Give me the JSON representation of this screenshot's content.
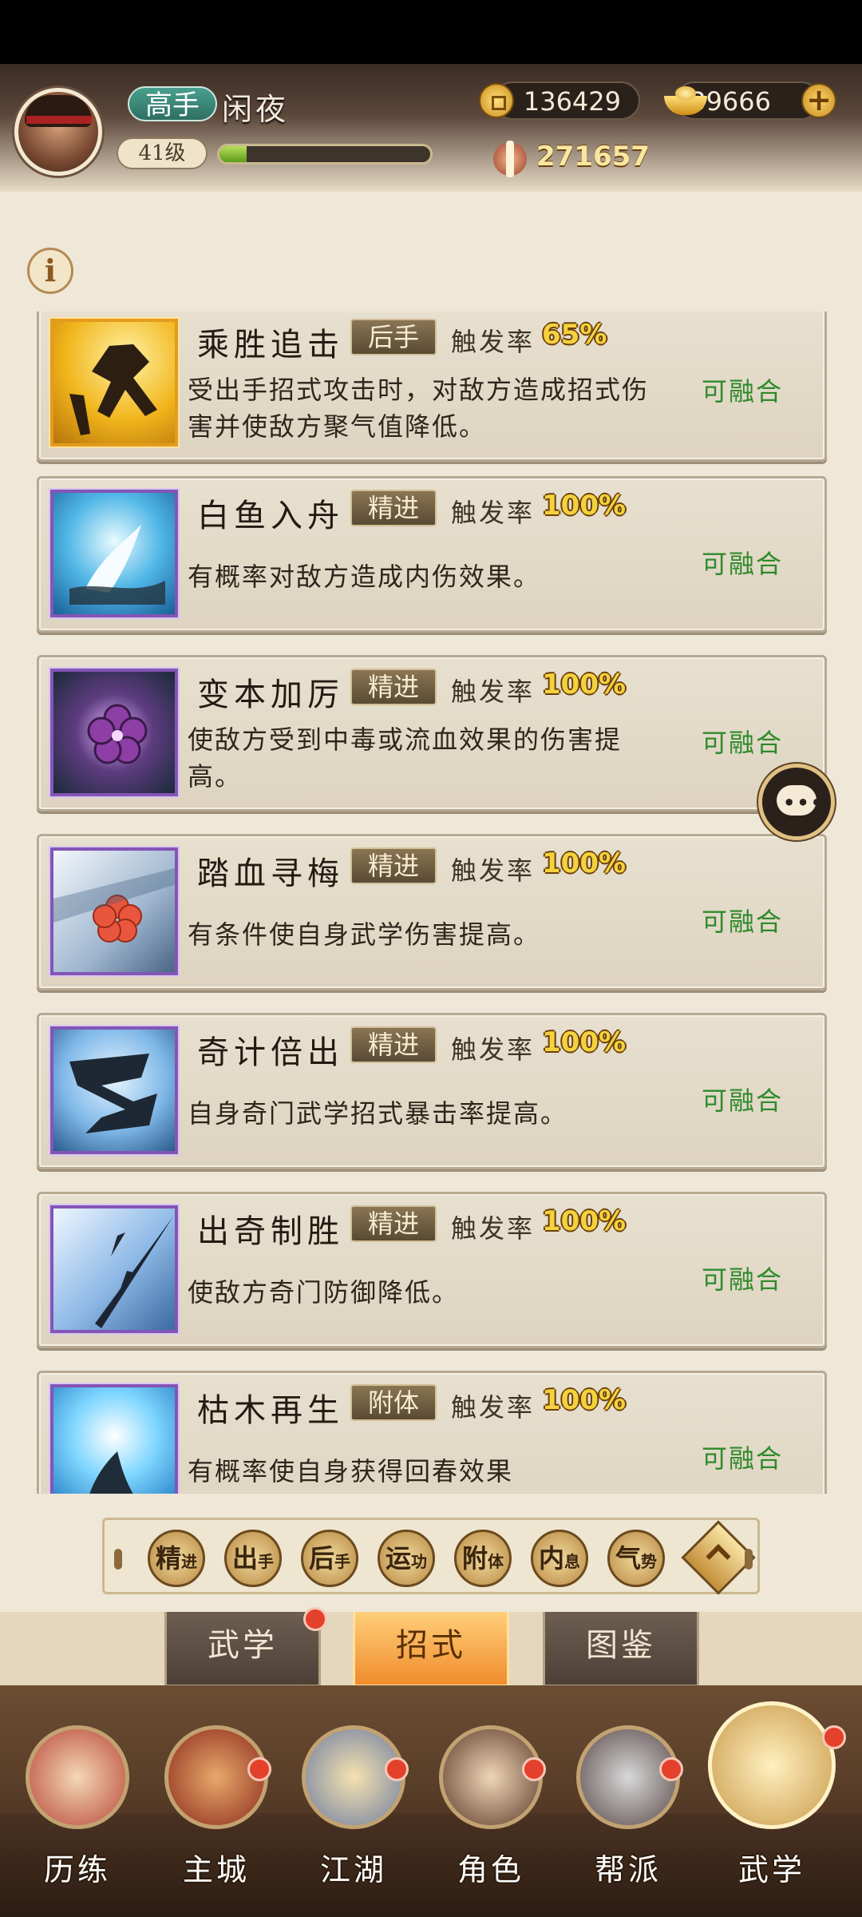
{
  "header": {
    "rank": "高手",
    "name": "闲夜",
    "level": "41级",
    "exp_progress": 0.13,
    "coins": "136429",
    "ingots": "39666",
    "plus": "+",
    "power": "271657"
  },
  "info_button": "i",
  "skills": [
    {
      "name": "乘胜追击",
      "tag": "后手",
      "rate_label": "触发率",
      "rate": "65%",
      "desc": "受出手招式攻击时，对敌方造成招式伤害并使敌方聚气值降低。",
      "action": "可融合",
      "icon": "gold-runner"
    },
    {
      "name": "白鱼入舟",
      "tag": "精进",
      "rate_label": "触发率",
      "rate": "100%",
      "desc": "有概率对敌方造成内伤效果。",
      "action": "可融合",
      "icon": "fish"
    },
    {
      "name": "变本加厉",
      "tag": "精进",
      "rate_label": "触发率",
      "rate": "100%",
      "desc": "使敌方受到中毒或流血效果的伤害提高。",
      "action": "可融合",
      "icon": "purple-flower"
    },
    {
      "name": "踏血寻梅",
      "tag": "精进",
      "rate_label": "触发率",
      "rate": "100%",
      "desc": "有条件使自身武学伤害提高。",
      "action": "可融合",
      "icon": "red-plum"
    },
    {
      "name": "奇计倍出",
      "tag": "精进",
      "rate_label": "触发率",
      "rate": "100%",
      "desc": "自身奇门武学招式暴击率提高。",
      "action": "可融合",
      "icon": "scroll"
    },
    {
      "name": "出奇制胜",
      "tag": "精进",
      "rate_label": "触发率",
      "rate": "100%",
      "desc": "使敌方奇门防御降低。",
      "action": "可融合",
      "icon": "darts"
    },
    {
      "name": "枯木再生",
      "tag": "附体",
      "rate_label": "触发率",
      "rate": "100%",
      "desc": "有概率使自身获得回春效果",
      "action": "可融合",
      "icon": "sprout"
    }
  ],
  "filters": [
    {
      "main": "精",
      "sub": "进"
    },
    {
      "main": "出",
      "sub": "手"
    },
    {
      "main": "后",
      "sub": "手"
    },
    {
      "main": "运",
      "sub": "功"
    },
    {
      "main": "附",
      "sub": "体"
    },
    {
      "main": "内",
      "sub": "息"
    },
    {
      "main": "气",
      "sub": "势"
    }
  ],
  "tabs": [
    "武学",
    "招式",
    "图鉴"
  ],
  "nav": [
    "历练",
    "主城",
    "江湖",
    "角色",
    "帮派",
    "武学"
  ],
  "colors": {
    "accent": "#f08c2c",
    "fuse_green": "#2e8a2c",
    "rate_gold": "#f4d23e",
    "badge_red": "#e4412c"
  }
}
